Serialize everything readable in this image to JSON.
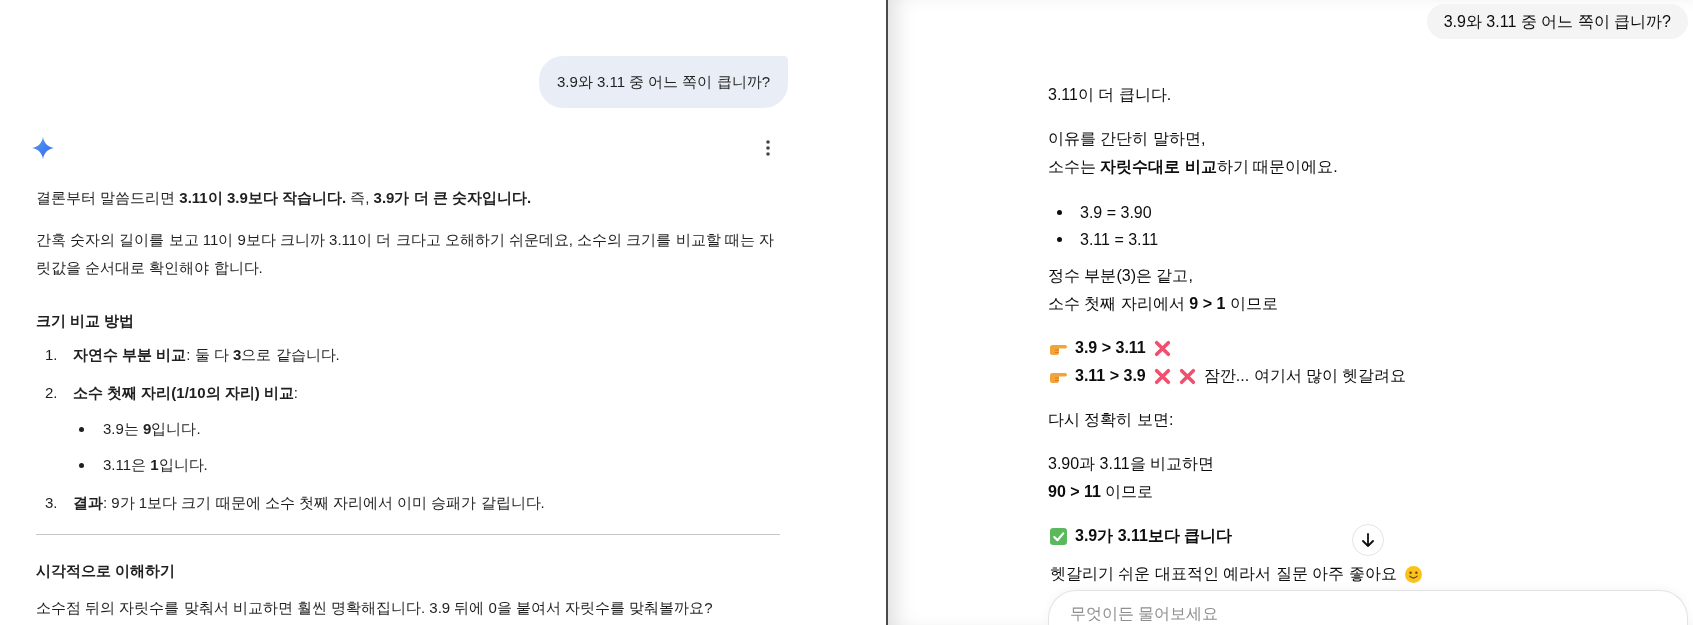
{
  "left_panel": {
    "user_message": "3.9와 3.11 중 어느 쪽이 큽니까?",
    "response": [
      {
        "kind": "paragraph",
        "text": "결론부터 말씀드리면 **3.11이 3.9보다 작습니다.** 즉, **3.9가 더 큰 숫자입니다.**"
      },
      {
        "kind": "paragraph",
        "text": "간혹 숫자의 길이를 보고 11이 9보다 크니까 3.11이 더 크다고 오해하기 쉬운데요, 소수의 크기를 비교할 때는 자릿값을 순서대로 확인해야 합니다."
      },
      {
        "kind": "heading",
        "text": "크기 비교 방법"
      },
      {
        "kind": "ordered_list",
        "items": [
          {
            "number": "1.",
            "text": "**자연수 부분 비교**: 둘 다 **3**으로 같습니다."
          },
          {
            "number": "2.",
            "text": "**소수 첫째 자리(1/10의 자리) 비교**:",
            "children": [
              "3.9는 **9**입니다.",
              "3.11은 **1**입니다."
            ]
          },
          {
            "number": "3.",
            "text": "**결과**: 9가 1보다 크기 때문에 소수 첫째 자리에서 이미 승패가 갈립니다."
          }
        ]
      },
      {
        "kind": "divider"
      },
      {
        "kind": "heading",
        "text": "시각적으로 이해하기"
      },
      {
        "kind": "paragraph",
        "text": "소수점 뒤의 자릿수를 맞춰서 비교하면 훨씬 명확해집니다. 3.9 뒤에 0을 붙여서 자릿수를 맞춰볼까요?"
      }
    ]
  },
  "right_panel": {
    "user_message": "3.9와 3.11 중 어느 쪽이 큽니까?",
    "response": [
      {
        "kind": "paragraph",
        "lines": [
          "3.11이 더 큽니다."
        ]
      },
      {
        "kind": "paragraph",
        "lines": [
          "이유를 간단히 말하면,",
          "소수는 **자릿수대로 비교**하기 때문이에요."
        ]
      },
      {
        "kind": "bullets",
        "items": [
          "3.9 = 3.90",
          "3.11 = 3.11"
        ]
      },
      {
        "kind": "paragraph",
        "lines": [
          "정수 부분(3)은 같고,",
          "소수 첫째 자리에서 **9 > 1** 이므로"
        ]
      },
      {
        "kind": "icon_lines",
        "lines": [
          [
            {
              "kind": "pointer"
            },
            {
              "kind": "bold",
              "text": "3.9 > 3.11"
            },
            {
              "kind": "cross"
            }
          ],
          [
            {
              "kind": "pointer"
            },
            {
              "kind": "bold",
              "text": "3.11 > 3.9"
            },
            {
              "kind": "cross"
            },
            {
              "kind": "cross"
            },
            {
              "kind": "text",
              "text": "잠깐... 여기서 많이 헷갈려요"
            }
          ]
        ]
      },
      {
        "kind": "paragraph",
        "lines": [
          "다시 정확히 보면:"
        ]
      },
      {
        "kind": "paragraph",
        "lines": [
          "3.90과 3.11을 비교하면",
          "**90 > 11** 이므로"
        ]
      },
      {
        "kind": "icon_lines",
        "lines": [
          [
            {
              "kind": "check"
            },
            {
              "kind": "bold",
              "text": "3.9가 3.11보다 큽니다"
            }
          ]
        ]
      },
      {
        "kind": "icon_lines",
        "lines": [
          [
            {
              "kind": "text",
              "text": "헷갈리기 쉬운 대표적인 예라서 질문 아주 좋아요"
            },
            {
              "kind": "smiley"
            }
          ]
        ]
      }
    ],
    "composer": {
      "placeholder": "무엇이든 물어보세요"
    }
  }
}
